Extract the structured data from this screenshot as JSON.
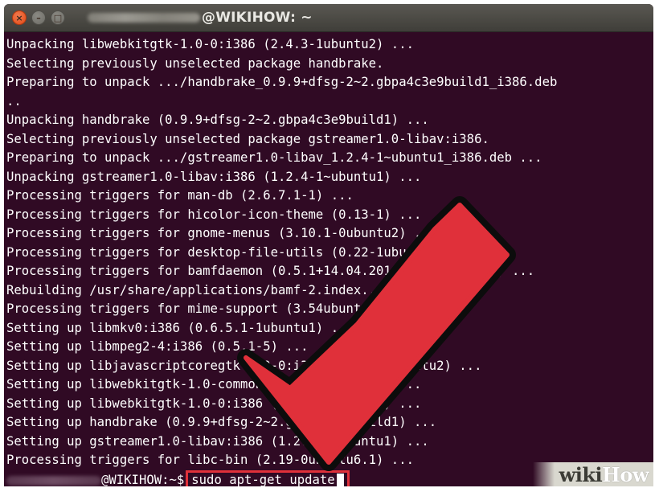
{
  "window": {
    "title": "@WIKIHOW: ~",
    "buttons": {
      "close": "×",
      "minimize": "–",
      "maximize": "□"
    }
  },
  "terminal": {
    "lines": [
      "Unpacking libwebkitgtk-1.0-0:i386 (2.4.3-1ubuntu2) ...",
      "Selecting previously unselected package handbrake.",
      "Preparing to unpack .../handbrake_0.9.9+dfsg-2~2.gbpa4c3e9build1_i386.deb",
      "..",
      "Unpacking handbrake (0.9.9+dfsg-2~2.gbpa4c3e9build1) ...",
      "Selecting previously unselected package gstreamer1.0-libav:i386.",
      "Preparing to unpack .../gstreamer1.0-libav_1.2.4-1~ubuntu1_i386.deb ...",
      "Unpacking gstreamer1.0-libav:i386 (1.2.4-1~ubuntu1) ...",
      "Processing triggers for man-db (2.6.7.1-1) ...",
      "Processing triggers for hicolor-icon-theme (0.13-1) ...",
      "Processing triggers for gnome-menus (3.10.1-0ubuntu2) ...",
      "Processing triggers for desktop-file-utils (0.22-1ubuntu1) ...",
      "Processing triggers for bamfdaemon (0.5.1+14.04.20140409-0ubuntu1) ...",
      "Rebuilding /usr/share/applications/bamf-2.index...",
      "Processing triggers for mime-support (3.54ubuntu1) ...",
      "Setting up libmkv0:i386 (0.6.5.1-1ubuntu1) ...",
      "Setting up libmpeg2-4:i386 (0.5.1-5) ...",
      "Setting up libjavascriptcoregtk-1.0-0:i386 (2.4.3-1ubuntu2) ...",
      "Setting up libwebkitgtk-1.0-common (2.4.3-1ubuntu2) ...",
      "Setting up libwebkitgtk-1.0-0:i386 (2.4.3-1ubuntu2) ...",
      "Setting up handbrake (0.9.9+dfsg-2~2.gbpa4c3e9build1) ...",
      "Setting up gstreamer1.0-libav:i386 (1.2.4-1~ubuntu1) ...",
      "Processing triggers for libc-bin (2.19-0ubuntu6.1) ..."
    ],
    "prompt": "@WIKIHOW:~$",
    "command": "sudo apt-get update"
  },
  "watermark": {
    "wiki": "wiki",
    "how": "How"
  },
  "colors": {
    "terminal_bg": "#300a24",
    "highlight": "#e0303a",
    "arrow": "#e0303a"
  }
}
